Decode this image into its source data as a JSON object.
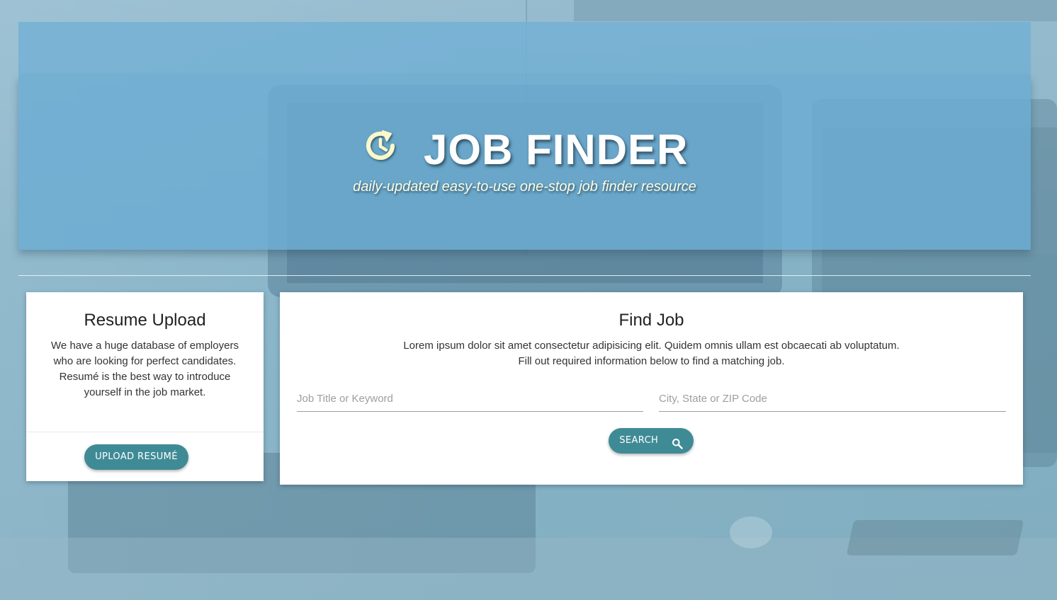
{
  "hero": {
    "title": "JOB FINDER",
    "tagline": "daily-updated easy-to-use one-stop job finder resource",
    "logo_icon": "clock-refresh-icon",
    "logo_color": "#fbf8cc"
  },
  "resume_card": {
    "title": "Resume Upload",
    "description": "We have a huge database of employers who are looking for perfect candidates. Resumé is the best way to introduce yourself in the job market.",
    "button_label": "UPLOAD RESUMÉ"
  },
  "find_card": {
    "title": "Find Job",
    "description_line1": "Lorem ipsum dolor sit amet consectetur adipisicing elit. Quidem omnis ullam est obcaecati ab voluptatum.",
    "description_line2": "Fill out required information below to find a matching job.",
    "keyword_input": {
      "placeholder": "Job Title or Keyword",
      "value": ""
    },
    "location_input": {
      "placeholder": "City, State or ZIP Code",
      "value": ""
    },
    "search_button_label": "SEARCH",
    "search_icon": "search-icon"
  },
  "colors": {
    "accent": "#3f8b95",
    "hero_bg": "#6bacd2",
    "tagline": "#fdfde3"
  }
}
